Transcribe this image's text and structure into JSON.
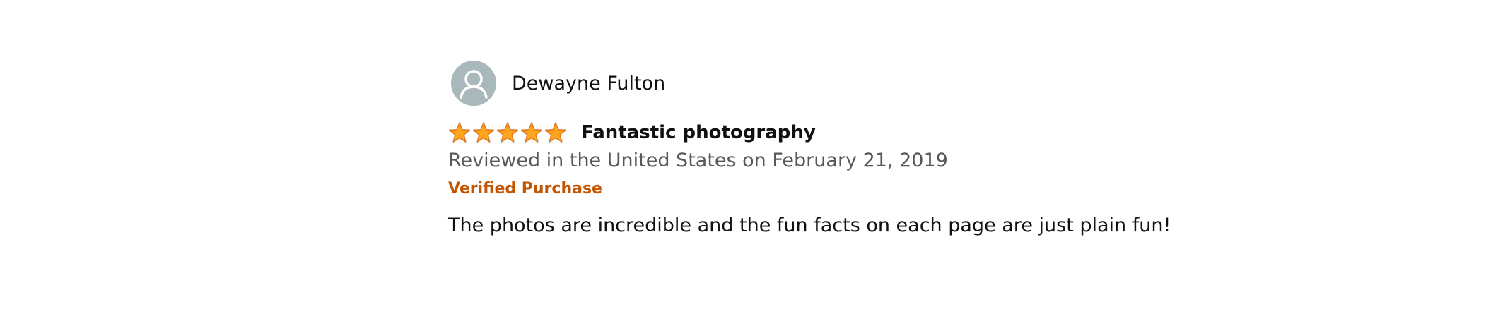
{
  "reviewer": {
    "name": "Dewayne Fulton",
    "avatar_icon": "person-silhouette-icon"
  },
  "review": {
    "rating": 5,
    "rating_max": 5,
    "title": "Fantastic photography",
    "meta": "Reviewed in the United States on February 21, 2019",
    "badge": "Verified Purchase",
    "body": "The photos are incredible and the fun facts on each page are just plain fun!"
  },
  "colors": {
    "star_fill": "#ffa41c",
    "star_stroke": "#de7921",
    "badge": "#c45500",
    "meta": "#565959",
    "avatar_bg": "#a9b8bb"
  }
}
